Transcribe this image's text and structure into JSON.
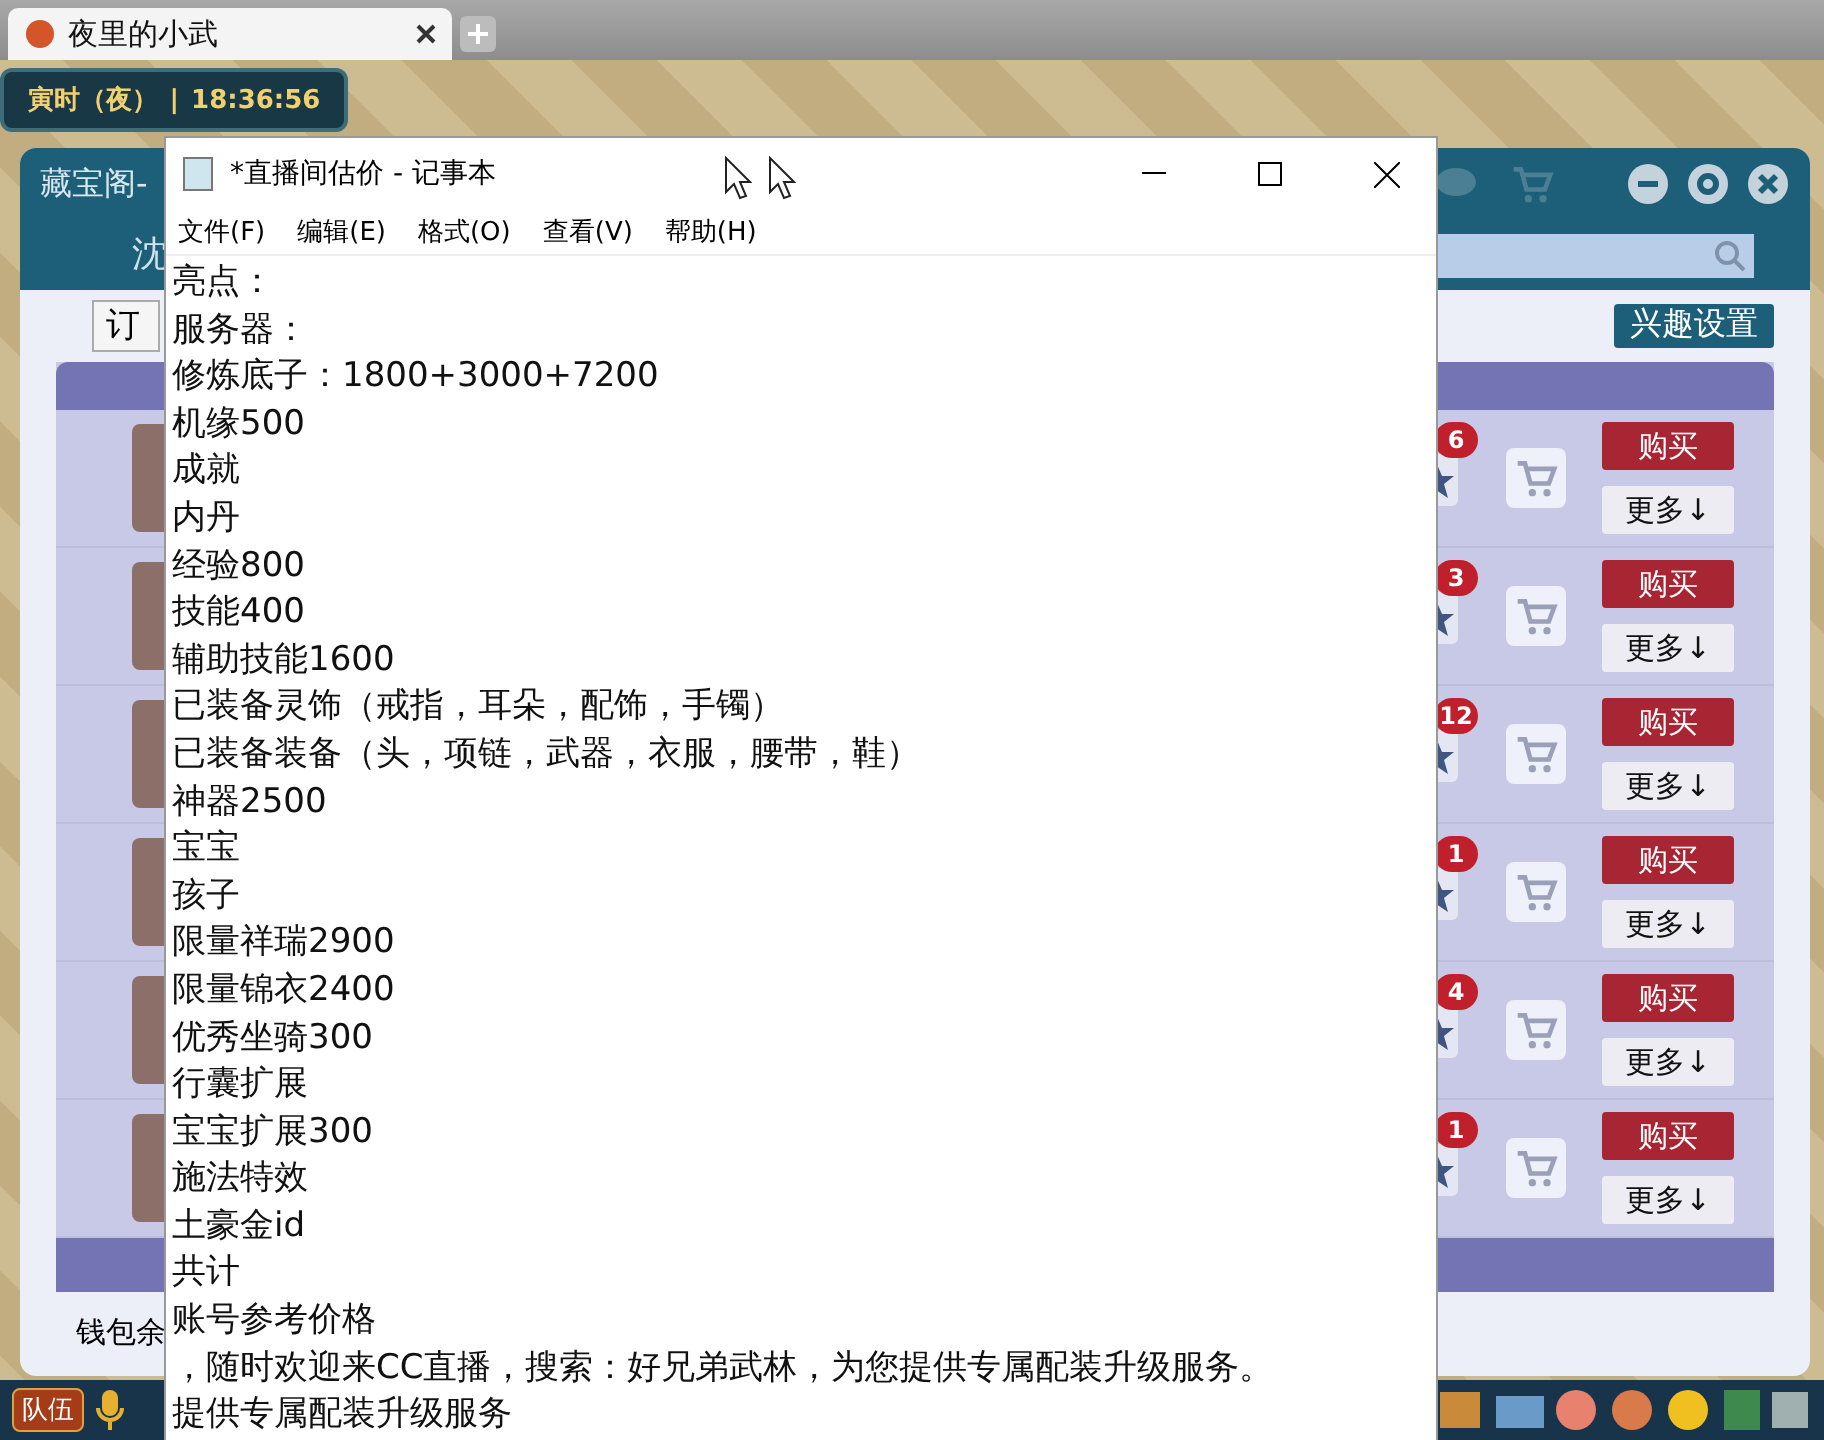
{
  "browser_tab": {
    "title": "夜里的小武",
    "selected": true
  },
  "game": {
    "clock": {
      "period": "寅时（夜）",
      "separator": "|",
      "time": "18:36:56"
    },
    "panel": {
      "title": "藏宝阁-",
      "tab": "沈",
      "filter": "订",
      "interest_button": "兴趣设置",
      "wallet": "钱包余",
      "rows": [
        {
          "count": "6",
          "buy": "购买",
          "more": "更多↓"
        },
        {
          "count": "3",
          "buy": "购买",
          "more": "更多↓"
        },
        {
          "count": "12",
          "buy": "购买",
          "more": "更多↓"
        },
        {
          "count": "1",
          "buy": "购买",
          "more": "更多↓"
        },
        {
          "count": "4",
          "buy": "购买",
          "more": "更多↓"
        },
        {
          "count": "1",
          "buy": "购买",
          "more": "更多↓"
        }
      ]
    },
    "taskbar": {
      "team_button": "队伍"
    }
  },
  "notepad": {
    "title": "*直播间估价 - 记事本",
    "menu": [
      "文件(F)",
      "编辑(E)",
      "格式(O)",
      "查看(V)",
      "帮助(H)"
    ],
    "lines": [
      "亮点：",
      "服务器：",
      "修炼底子：1800+3000+7200",
      "机缘500",
      "成就",
      "内丹",
      "经验800",
      "技能400",
      "辅助技能1600",
      "已装备灵饰（戒指，耳朵，配饰，手镯）",
      "已装备装备（头，项链，武器，衣服，腰带，鞋）",
      "神器2500",
      "宝宝",
      "孩子",
      "限量祥瑞2900",
      "限量锦衣2400",
      "优秀坐骑300",
      "行囊扩展",
      "宝宝扩展300",
      "施法特效",
      "土豪金id",
      "共计",
      "账号参考价格",
      "，随时欢迎来CC直播，搜索：好兄弟武林，为您提供专属配装升级服务。",
      "提供专属配装升级服务"
    ]
  }
}
